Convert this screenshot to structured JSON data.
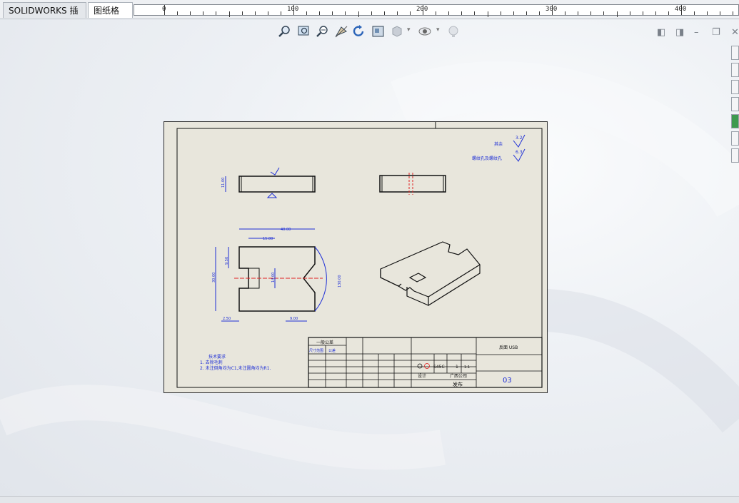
{
  "tabs": [
    {
      "label": "SOLIDWORKS 插件",
      "active": false
    },
    {
      "label": "图纸格式",
      "active": true
    }
  ],
  "ruler": {
    "labels": [
      "0",
      "100",
      "200",
      "300",
      "400"
    ]
  },
  "toolbar_icons": [
    "zoom-to-fit-icon",
    "zoom-to-area-icon",
    "previous-view-icon",
    "section-view-icon",
    "rotate-view-icon",
    "view-orientation-icon",
    "display-style-icon",
    "hide-show-icon",
    "appearance-icon"
  ],
  "window_controls": [
    "tile-left-icon",
    "tile-right-icon",
    "minimize-icon",
    "restore-icon",
    "close-icon"
  ],
  "taskpane_icons": [
    "home-icon",
    "resources-icon",
    "design-library-icon",
    "file-explorer-icon",
    "appearance-globe-icon",
    "custom-properties-icon",
    "forum-icon"
  ],
  "drawing": {
    "surface_note_1": "其余",
    "surface_note_2": "螺纹孔及螺纹孔",
    "surface_val_1": "3.2",
    "surface_val_2": "6.3",
    "tech_title": "技术要求",
    "tech_1": "1. 去除毛刺",
    "tech_2": "2. 未注倒角均为C1,未注圆角均为R1.",
    "dims": {
      "d1": "11.00",
      "d2": "40.00",
      "d3": "15.00",
      "d4": "30.00",
      "d5": "9.50",
      "d6": "14.00",
      "d7": "130.00",
      "d8": "2.50",
      "d9": "9.00"
    },
    "title_block": {
      "tolerance_title": "一般公差",
      "size_label": "尺寸范围",
      "tol_label": "公差",
      "material": "S45C",
      "qty": "1",
      "part_name": "反面 USB",
      "drawing_no": "03",
      "designer": "设计",
      "company": "广西公司",
      "status": "发布",
      "scale": "1:1"
    }
  },
  "colors": {
    "sheet_bg": "#e8e6dc",
    "dimension_blue": "#1e2fd6",
    "centerline_red": "#e02020",
    "geometry": "#111111"
  }
}
